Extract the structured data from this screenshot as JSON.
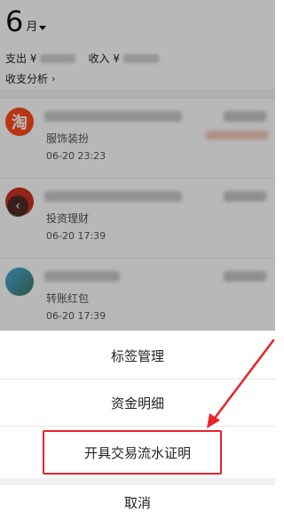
{
  "header": {
    "month": "6",
    "month_unit": "月",
    "expense_label": "支出 ¥",
    "income_label": "收入 ¥",
    "analysis_label": "收支分析",
    "analysis_chevron": "›"
  },
  "transactions": [
    {
      "icon": "taobao-icon",
      "icon_text": "淘",
      "category": "服饰装扮",
      "time": "06-20  23:23"
    },
    {
      "icon": "fund-icon",
      "icon_text": "",
      "category": "投资理财",
      "time": "06-20  17:39"
    },
    {
      "icon": "transfer-icon",
      "icon_text": "",
      "category": "转账红包",
      "time": "06-20  17:39"
    }
  ],
  "nav": {
    "back_glyph": "‹"
  },
  "action_sheet": {
    "items": [
      {
        "label": "标签管理"
      },
      {
        "label": "资金明细"
      },
      {
        "label": "开具交易流水证明"
      }
    ],
    "cancel_label": "取消"
  },
  "annotation": {
    "highlight_color": "#e8222b"
  }
}
